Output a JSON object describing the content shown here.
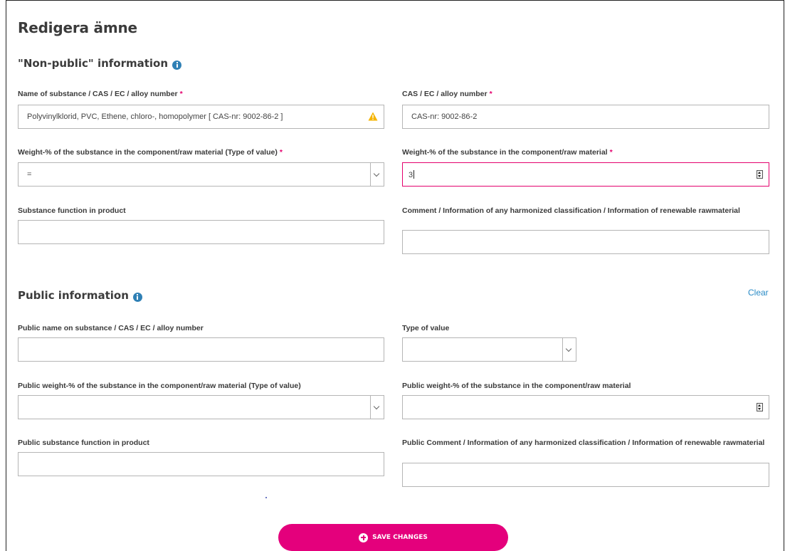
{
  "page": {
    "title": "Redigera ämne"
  },
  "nonpublic": {
    "heading": "\"Non-public\" information",
    "name_label": "Name of substance / CAS / EC / alloy number",
    "name_value": "Polyvinylklorid, PVC, Ethene, chloro-, homopolymer [ CAS-nr: 9002-86-2 ]",
    "cas_label": "CAS / EC / alloy number",
    "cas_value": "CAS-nr: 9002-86-2",
    "type_label": "Weight-% of the substance in the component/raw material (Type of value)",
    "type_value": "=",
    "weight_label": "Weight-% of the substance in the component/raw material",
    "weight_value": "3",
    "function_label": "Substance function in product",
    "function_value": "",
    "comment_label": "Comment / Information of any harmonized classification / Information of renewable rawmaterial",
    "comment_value": ""
  },
  "public": {
    "heading": "Public information",
    "clear_label": "Clear",
    "name_label": "Public name on substance / CAS / EC / alloy number",
    "name_value": "",
    "typeofvalue_label": "Type of value",
    "typeofvalue_value": "",
    "type_label": "Public weight-% of the substance in the component/raw material (Type of value)",
    "type_value": "",
    "weight_label": "Public weight-% of the substance in the component/raw material",
    "weight_value": "",
    "function_label": "Public substance function in product",
    "function_value": "",
    "comment_label": "Public Comment / Information of any harmonized classification / Information of renewable rawmaterial",
    "comment_value": ""
  },
  "required_marker": "*",
  "save_button": {
    "label": "SAVE CHANGES"
  },
  "colors": {
    "accent": "#e4007c",
    "link": "#2a8bc6",
    "info": "#2f80b5",
    "warning": "#f5b400"
  },
  "icons": {
    "info": "info-icon",
    "warning": "warning-icon",
    "dropdown": "chevron-down-icon",
    "spinner": "spinner-icon",
    "save": "plus-circle-icon"
  }
}
